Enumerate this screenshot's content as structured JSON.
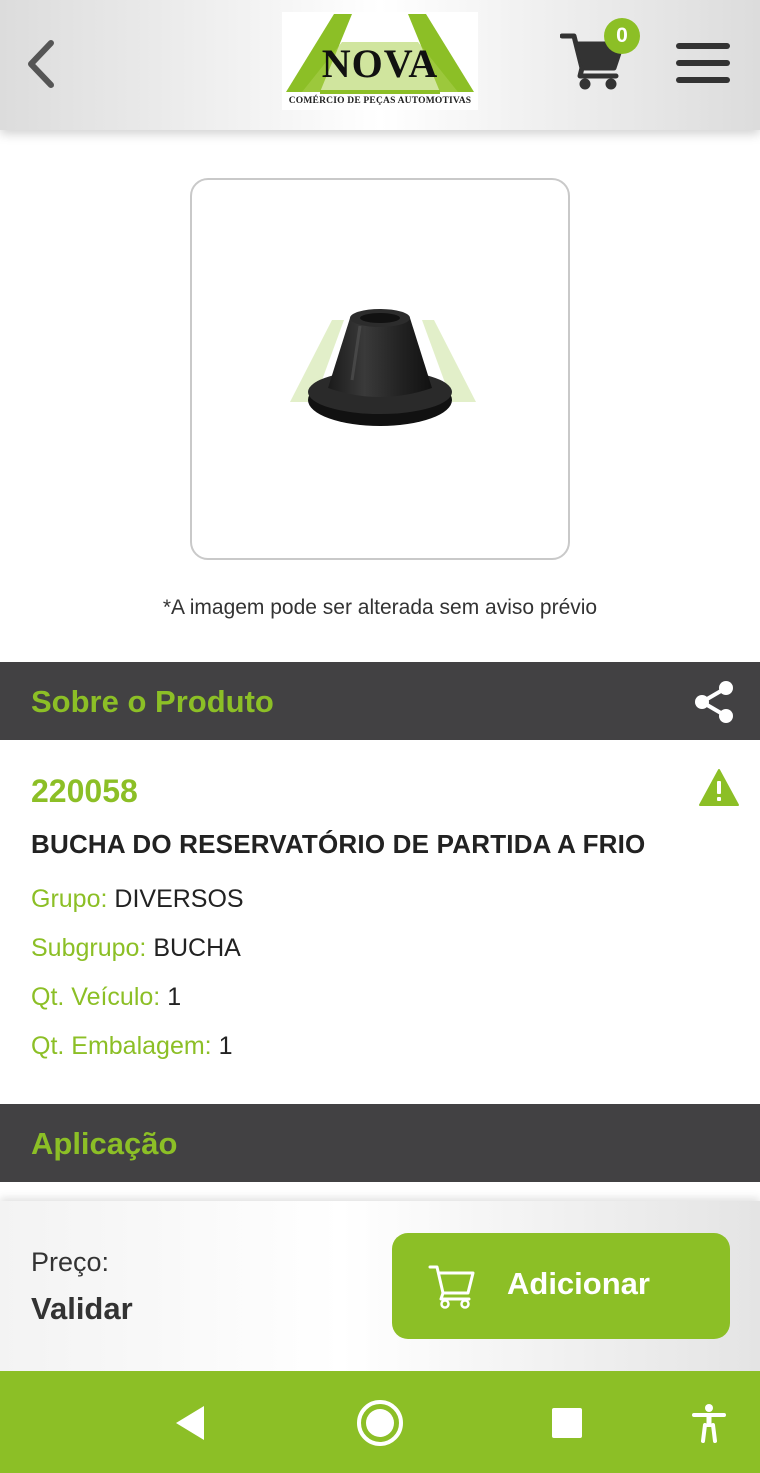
{
  "header": {
    "logo_text": "NOVA",
    "logo_subtitle": "COMÉRCIO DE PEÇAS AUTOMOTIVAS",
    "cart_count": "0",
    "icons": {
      "back": "chevron-left-icon",
      "cart": "cart-icon",
      "menu": "hamburger-menu-icon"
    }
  },
  "product_image": {
    "note": "*A imagem pode ser alterada sem aviso prévio"
  },
  "about": {
    "title": "Sobre o Produto",
    "share_icon": "share-icon"
  },
  "product": {
    "code": "220058",
    "name": "BUCHA DO RESERVATÓRIO DE PARTIDA A FRIO",
    "warning_icon": "warning-icon",
    "attributes": [
      {
        "label": "Grupo:",
        "value": "DIVERSOS"
      },
      {
        "label": "Subgrupo:",
        "value": "BUCHA"
      },
      {
        "label": "Qt. Veículo:",
        "value": "1"
      },
      {
        "label": "Qt. Embalagem:",
        "value": "1"
      }
    ]
  },
  "application": {
    "title": "Aplicação"
  },
  "purchase": {
    "price_label": "Preço:",
    "price_value": "Validar",
    "add_button_label": "Adicionar"
  },
  "colors": {
    "brand_green": "#8cbf26",
    "section_bar": "#424143"
  }
}
